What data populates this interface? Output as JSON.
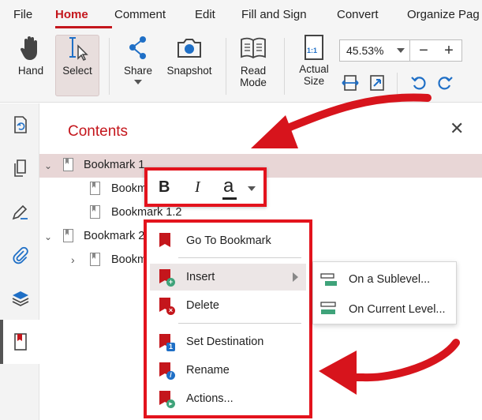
{
  "menubar": {
    "items": [
      "File",
      "Home",
      "Comment",
      "Edit",
      "Fill and Sign",
      "Convert",
      "Organize Pag"
    ],
    "active": "Home"
  },
  "ribbon": {
    "hand": "Hand",
    "select": "Select",
    "share": "Share",
    "snapshot": "Snapshot",
    "read_mode_line1": "Read",
    "read_mode_line2": "Mode",
    "actual_size_line1": "Actual",
    "actual_size_line2": "Size",
    "actual_size_icon_text": "1:1",
    "zoom_value": "45.53%",
    "zoom_out": "−",
    "zoom_in": "+"
  },
  "panel": {
    "title": "Contents",
    "close": "✕",
    "bookmarks": [
      {
        "label": "Bookmark 1"
      },
      {
        "label": "Bookm"
      },
      {
        "label": "Bookmark 1.2"
      },
      {
        "label": "Bookmark 2"
      },
      {
        "label": "Bookm"
      }
    ]
  },
  "format_toolbar": {
    "bold": "B",
    "italic": "I",
    "color": "a"
  },
  "context_menu": {
    "items": [
      {
        "label": "Go To Bookmark"
      },
      {
        "label": "Insert"
      },
      {
        "label": "Delete"
      },
      {
        "label": "Set Destination"
      },
      {
        "label": "Rename"
      },
      {
        "label": "Actions..."
      }
    ],
    "submenu": [
      {
        "label": "On a Sublevel..."
      },
      {
        "label": "On Current Level..."
      }
    ]
  },
  "colors": {
    "accent": "#c4161c",
    "highlight_box": "#e3131d",
    "ribbon_icon_blue": "#1f6fc6",
    "submenu_icon_green": "#3fa37a"
  }
}
